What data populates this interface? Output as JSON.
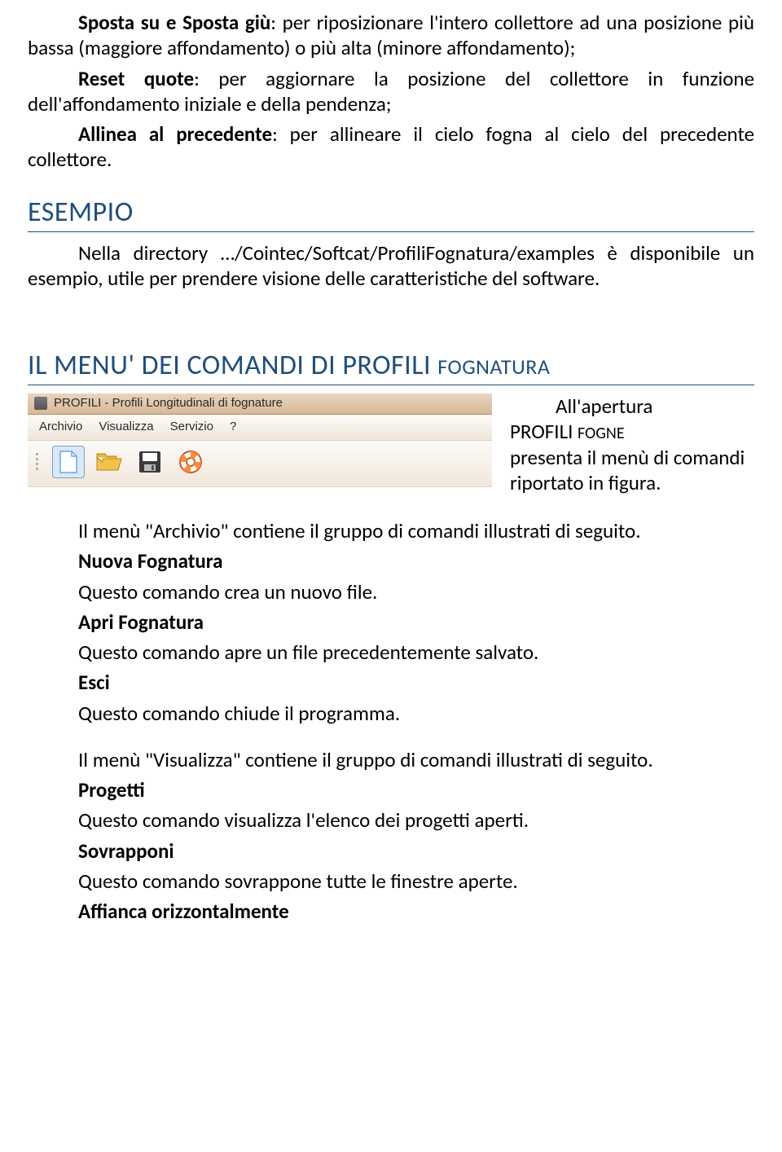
{
  "intro": {
    "t1_bold": "Sposta su e Sposta giù",
    "t1_rest": ": per riposizionare l'intero collettore ad una posizione più bassa (maggiore affondamento) o più alta (minore affondamento);",
    "t2_bold": "Reset quote",
    "t2_rest": ": per aggiornare la posizione del collettore in funzione dell'affondamento iniziale e della pendenza;",
    "t3_bold": "Allinea al precedente",
    "t3_rest": ": per allineare il cielo fogna al cielo del precedente collettore."
  },
  "esempio": {
    "heading": "ESEMPIO",
    "text": "Nella directory …/Cointec/Softcat/ProfiliFognatura/examples è disponibile un esempio, utile per prendere visione delle caratteristiche del software."
  },
  "menu_heading": {
    "main": "IL MENU' DEI COMANDI DI PROFILI ",
    "small": "FOGNATURA"
  },
  "menustrip": {
    "title": "PROFILI - Profili Longitudinali di fognature",
    "items": [
      "Archivio",
      "Visualizza",
      "Servizio",
      "?"
    ]
  },
  "side": {
    "l1_indent": "All'apertura",
    "l2a": "PROFILI ",
    "l2b_small": "FOGNE",
    "l3": "presenta il menù di comandi riportato in figura."
  },
  "body": {
    "p1": "Il menù \"Archivio\" contiene il gruppo di comandi illustrati di seguito.",
    "h1": "Nuova Fognatura",
    "p2": "Questo comando crea un nuovo file.",
    "h2": "Apri Fognatura",
    "p3": "Questo comando apre un file precedentemente salvato.",
    "h3": "Esci",
    "p4": "Questo comando chiude il programma.",
    "p5": "Il menù \"Visualizza\" contiene il gruppo di comandi illustrati di seguito.",
    "h4": "Progetti",
    "p6": "Questo comando visualizza l'elenco dei progetti aperti.",
    "h5": "Sovrapponi",
    "p7": "Questo comando sovrappone tutte le finestre aperte.",
    "h6": "Affianca orizzontalmente"
  }
}
